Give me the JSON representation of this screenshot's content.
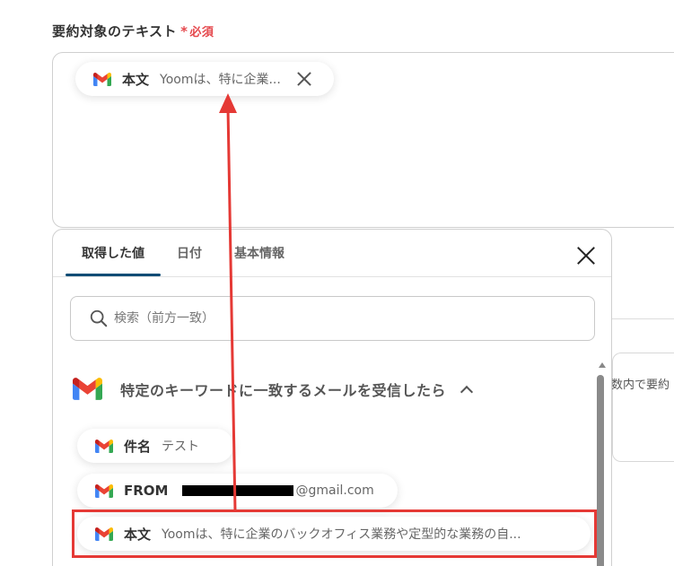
{
  "field": {
    "label": "要約対象のテキスト",
    "required_star": "*",
    "required_text": "必須"
  },
  "selected_chip": {
    "icon": "gmail-icon",
    "name": "本文",
    "value": "Yoomは、特に企業..."
  },
  "panel": {
    "tabs": [
      {
        "label": "取得した値",
        "active": true
      },
      {
        "label": "日付",
        "active": false
      },
      {
        "label": "基本情報",
        "active": false
      }
    ],
    "search_placeholder": "検索（前方一致）",
    "section": {
      "icon": "gmail-icon",
      "title": "特定のキーワードに一致するメールを受信したら"
    },
    "items": [
      {
        "name": "件名",
        "value": "テスト"
      },
      {
        "name": "FROM",
        "value": "@gmail.com",
        "redacted": true
      },
      {
        "name": "本文",
        "value": "Yoomは、特に企業のバックオフィス業務や定型的な業務の自..."
      }
    ]
  },
  "background": {
    "partial_text": "数内で要約"
  },
  "colors": {
    "required": "#e5484d",
    "tab_active_underline": "#0f4c75",
    "annotation_red": "#e53935"
  }
}
